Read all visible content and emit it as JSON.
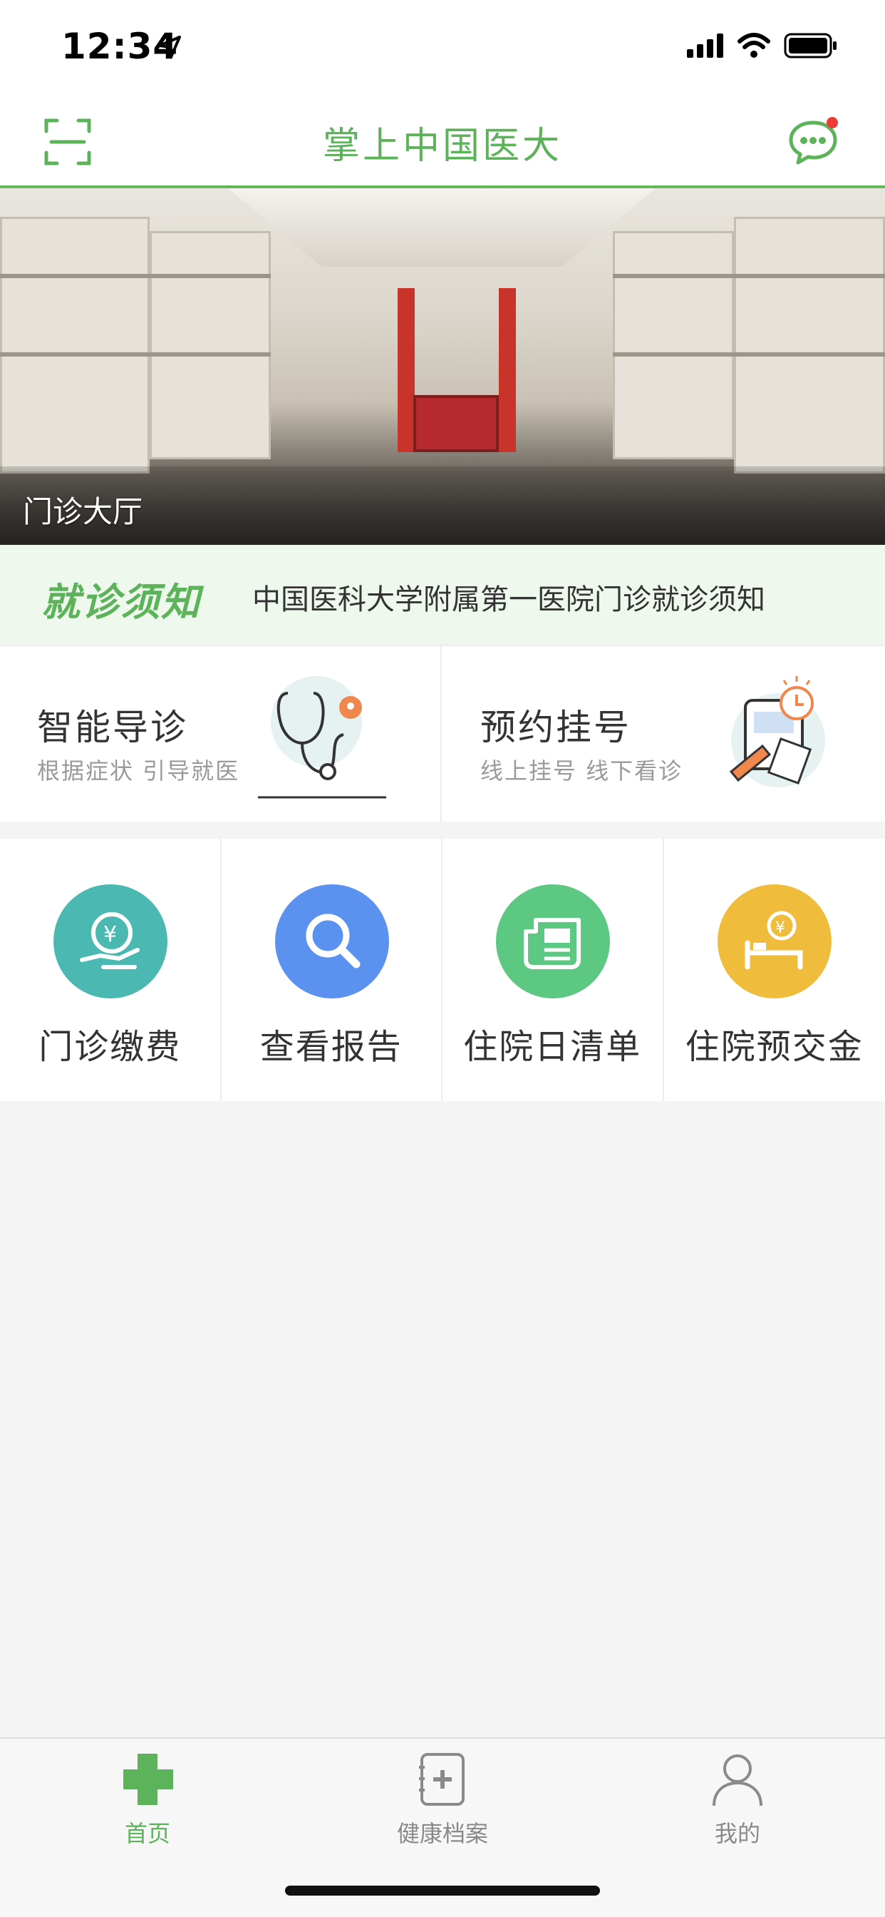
{
  "status_bar": {
    "time": "12:34",
    "icons": [
      "location-arrow-icon",
      "cellular-signal-icon",
      "wifi-icon",
      "battery-icon"
    ]
  },
  "nav": {
    "title": "掌上中国医大",
    "left_icon": "scan-icon",
    "right_icon": "message-icon",
    "has_unread_badge": true
  },
  "banner": {
    "caption": "门诊大厅",
    "slides": 3,
    "active_slide": 2
  },
  "notice": {
    "tag": "就诊须知",
    "text": "中国医科大学附属第一医院门诊就诊须知"
  },
  "features": [
    {
      "title": "智能导诊",
      "subtitle": "根据症状 引导就医",
      "icon": "stethoscope-icon"
    },
    {
      "title": "预约挂号",
      "subtitle": "线上挂号 线下看诊",
      "icon": "appointment-clock-icon"
    }
  ],
  "services": [
    {
      "label": "门诊缴费",
      "icon": "payment-hand-icon",
      "color": "#4cb8b2"
    },
    {
      "label": "查看报告",
      "icon": "search-icon",
      "color": "#5b92f0"
    },
    {
      "label": "住院日清单",
      "icon": "newspaper-icon",
      "color": "#5cc882"
    },
    {
      "label": "住院预交金",
      "icon": "bed-coin-icon",
      "color": "#f0bc3c"
    }
  ],
  "tabs": [
    {
      "label": "首页",
      "icon": "home-cross-icon",
      "active": true
    },
    {
      "label": "健康档案",
      "icon": "health-record-icon",
      "active": false
    },
    {
      "label": "我的",
      "icon": "profile-icon",
      "active": false
    }
  ],
  "colors": {
    "brand": "#5cb35a",
    "notice_bg": "#eef8ec",
    "page_bg": "#f4f4f4"
  }
}
